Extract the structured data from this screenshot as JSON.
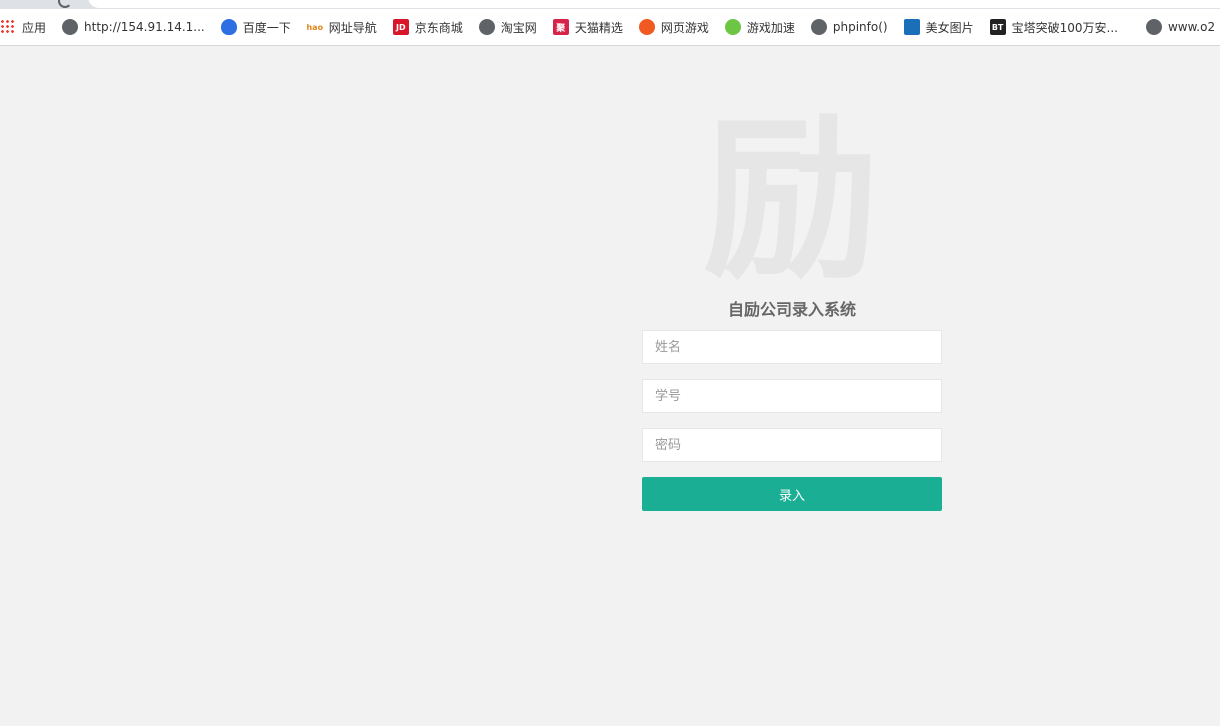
{
  "bookmarks": [
    {
      "label": "应用",
      "icon": "apps-icon"
    },
    {
      "label": "http://154.91.14.1...",
      "icon": "globe-icon"
    },
    {
      "label": "百度一下",
      "icon": "baidu-icon"
    },
    {
      "label": "网址导航",
      "icon": "hao123-icon",
      "icon_text": "hao"
    },
    {
      "label": "京东商城",
      "icon": "jd-icon",
      "icon_text": "JD"
    },
    {
      "label": "淘宝网",
      "icon": "globe-icon"
    },
    {
      "label": "天猫精选",
      "icon": "tmall-icon",
      "icon_text": "聚"
    },
    {
      "label": "网页游戏",
      "icon": "webgame-icon"
    },
    {
      "label": "游戏加速",
      "icon": "accelerator-icon"
    },
    {
      "label": "phpinfo()",
      "icon": "globe-icon"
    },
    {
      "label": "美女图片",
      "icon": "film-icon"
    },
    {
      "label": "宝塔突破100万安...",
      "icon": "bt-icon",
      "icon_text": "BT"
    },
    {
      "label": "www.o2",
      "icon": "globe-icon"
    }
  ],
  "login": {
    "logo_char": "励",
    "title": "自励公司录入系统",
    "name_placeholder": "姓名",
    "id_placeholder": "学号",
    "password_placeholder": "密码",
    "submit_label": "录入"
  },
  "colors": {
    "background": "#f2f2f2",
    "button": "#1aaf94"
  }
}
